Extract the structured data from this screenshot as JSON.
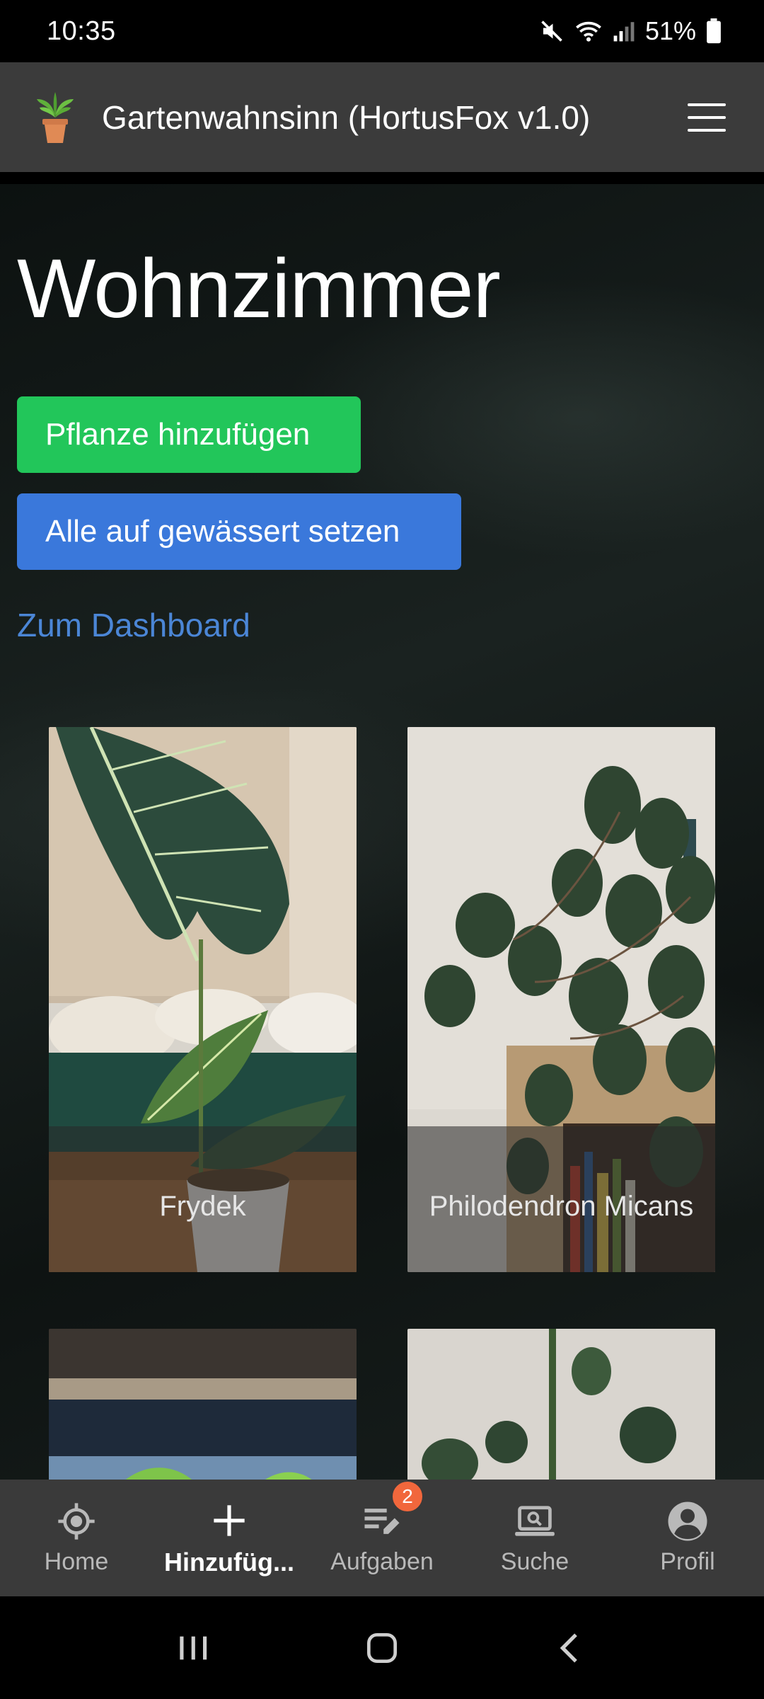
{
  "status_bar": {
    "time": "10:35",
    "battery": "51%"
  },
  "header": {
    "title": "Gartenwahnsinn (HortusFox v1.0)",
    "logo_icon": "potted-plant-icon",
    "menu_icon": "hamburger-menu-icon"
  },
  "main": {
    "title": "Wohnzimmer",
    "add_plant_label": "Pflanze hinzufügen",
    "set_all_watered_label": "Alle auf gewässert setzen",
    "dashboard_link": "Zum Dashboard",
    "plants": [
      {
        "name": "Frydek"
      },
      {
        "name": "Philodendron Micans"
      },
      {
        "name": ""
      },
      {
        "name": ""
      }
    ]
  },
  "bottom_nav": {
    "items": [
      {
        "label": "Home",
        "icon": "home-target-icon"
      },
      {
        "label": "Hinzufüg...",
        "icon": "plus-icon"
      },
      {
        "label": "Aufgaben",
        "icon": "tasks-edit-icon",
        "badge": "2"
      },
      {
        "label": "Suche",
        "icon": "laptop-search-icon"
      },
      {
        "label": "Profil",
        "icon": "account-circle-icon"
      }
    ],
    "active_index": 1
  },
  "colors": {
    "header_bg": "#3b3b3b",
    "add_button": "#22c65a",
    "water_button": "#3a78db",
    "link": "#4b86d6",
    "badge": "#f1673c",
    "fab_bg": "#2f3e34"
  }
}
